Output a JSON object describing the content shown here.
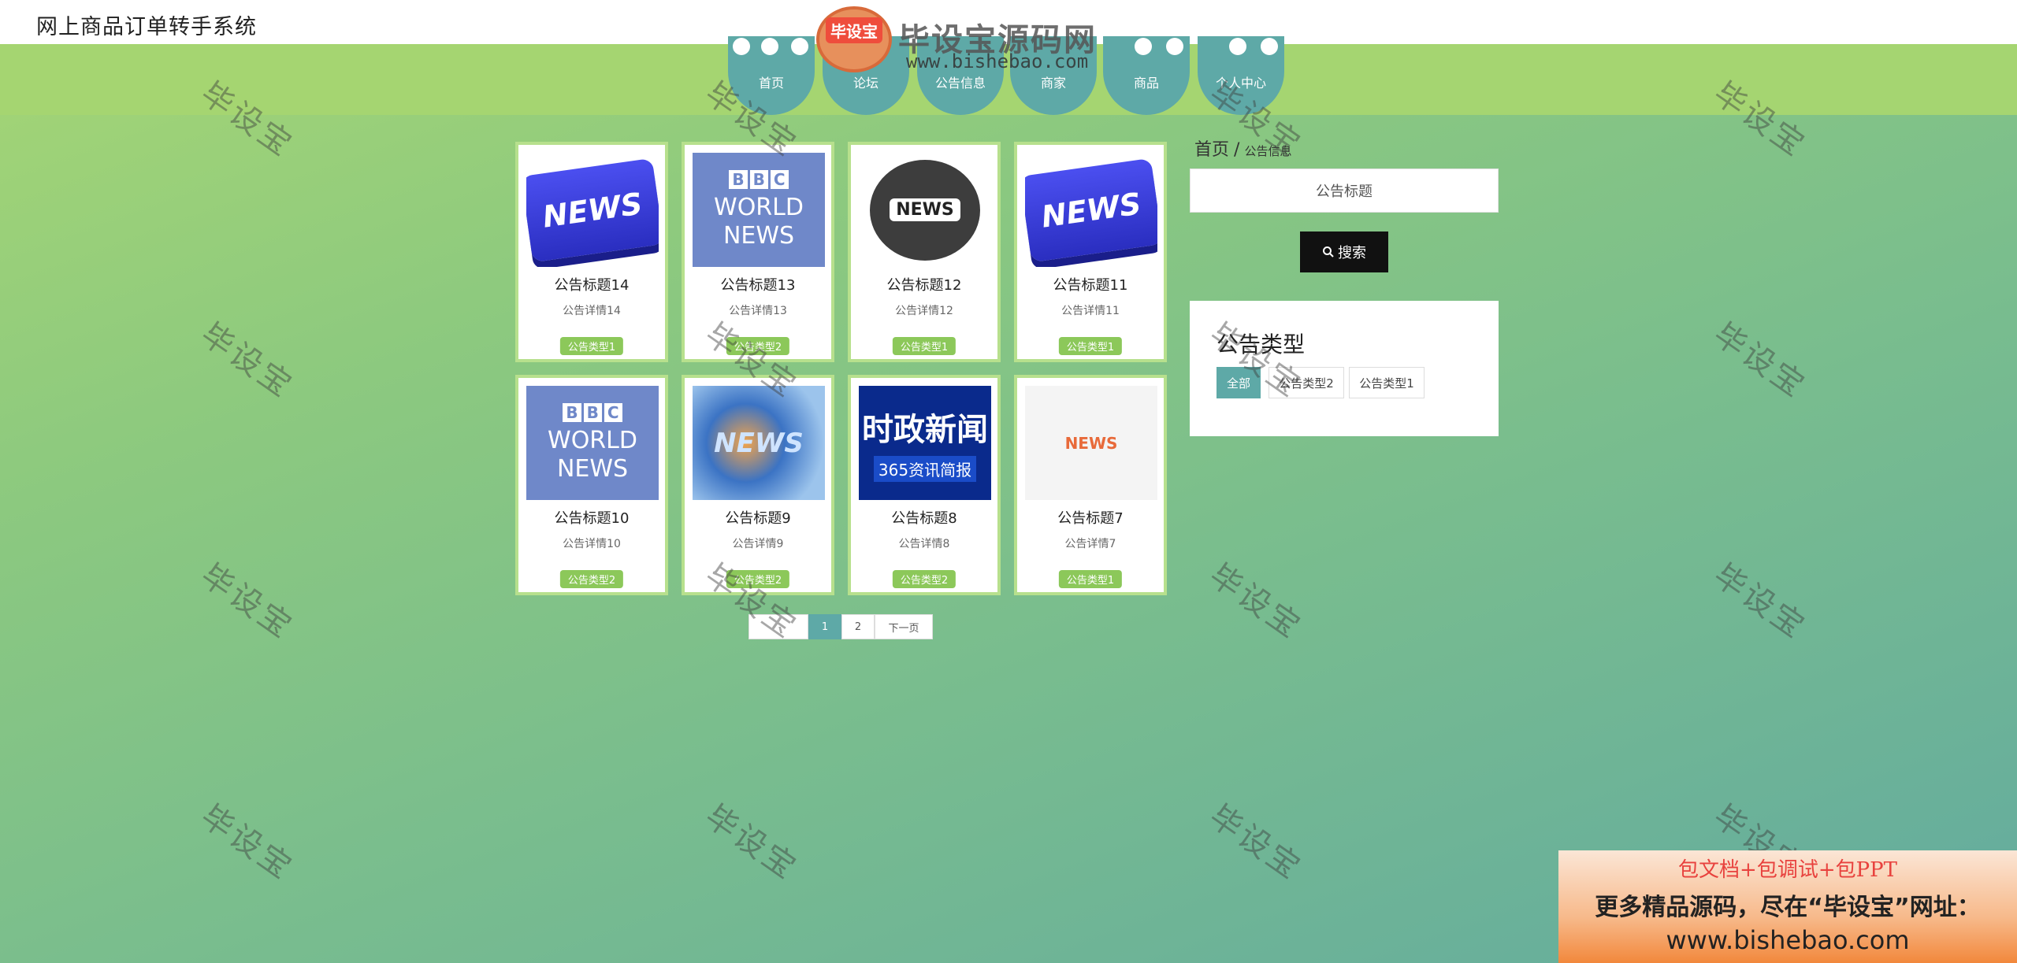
{
  "app_title": "网上商品订单转手系统",
  "logo": {
    "badge": "毕设宝",
    "name": "毕设宝源码网",
    "url": "www.bishebao.com"
  },
  "nav": [
    "首页",
    "论坛",
    "公告信息",
    "商家",
    "商品",
    "个人中心"
  ],
  "cards": [
    {
      "title": "公告标题14",
      "detail": "公告详情14",
      "type": "公告类型1",
      "image": "news-key"
    },
    {
      "title": "公告标题13",
      "detail": "公告详情13",
      "type": "公告类型2",
      "image": "bbc-world-news"
    },
    {
      "title": "公告标题12",
      "detail": "公告详情12",
      "type": "公告类型1",
      "image": "news-globe"
    },
    {
      "title": "公告标题11",
      "detail": "公告详情11",
      "type": "公告类型1",
      "image": "news-key"
    },
    {
      "title": "公告标题10",
      "detail": "公告详情10",
      "type": "公告类型2",
      "image": "bbc-world-news"
    },
    {
      "title": "公告标题9",
      "detail": "公告详情9",
      "type": "公告类型2",
      "image": "news-swirl"
    },
    {
      "title": "公告标题8",
      "detail": "公告详情8",
      "type": "公告类型2",
      "image": "shizheng-news"
    },
    {
      "title": "公告标题7",
      "detail": "公告详情7",
      "type": "公告类型1",
      "image": "news-paper"
    }
  ],
  "thumb_text": {
    "news": "NEWS",
    "bbc": [
      "B",
      "B",
      "C"
    ],
    "world": "WORLD",
    "shizheng": "时政新闻",
    "shizheng_sub": "365资讯简报"
  },
  "breadcrumb": {
    "home": "首页",
    "sep": "/",
    "current": "公告信息"
  },
  "search": {
    "placeholder": "公告标题",
    "button": "搜索"
  },
  "category": {
    "title": "公告类型",
    "options": [
      "全部",
      "公告类型2",
      "公告类型1"
    ],
    "active": "全部"
  },
  "pagination": {
    "pages": [
      "1",
      "2"
    ],
    "current": "1",
    "next": "下一页"
  },
  "watermark": "毕设宝",
  "promo": {
    "line1": "包文档+包调试+包PPT",
    "line2": "更多精品源码，尽在“毕设宝”网址：",
    "line3": "www.bishebao.com"
  },
  "colors": {
    "accent": "#5ea9a7",
    "nav_band": "#a5d571",
    "card_border": "#b7e08d",
    "badge": "#8cc85a"
  }
}
